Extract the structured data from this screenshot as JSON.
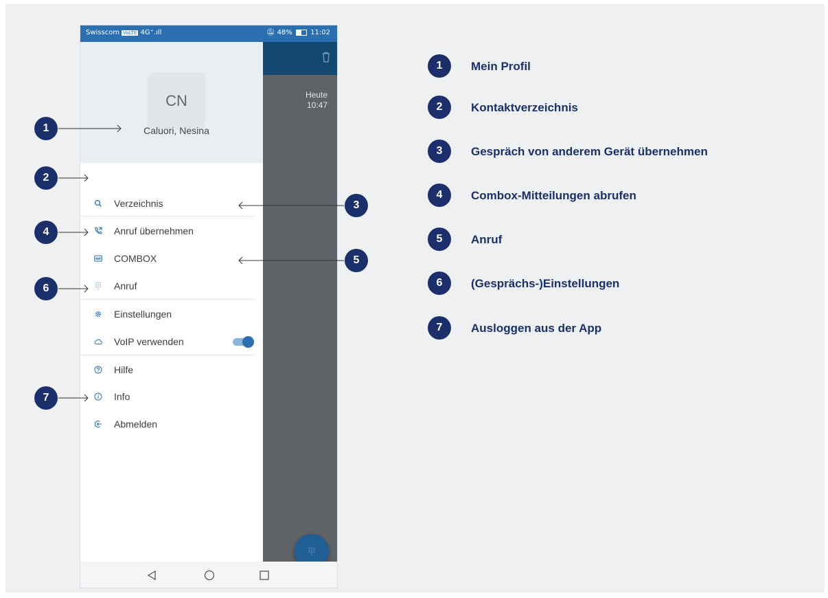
{
  "status_bar": {
    "carrier": "Swisscom",
    "network_tag": "VoLTE",
    "signal": "4G⁺.ıll",
    "battery": "48%",
    "time": "11:02"
  },
  "background_app": {
    "date_line1": "Heute",
    "date_line2": "10:47"
  },
  "profile": {
    "initials": "CN",
    "name": "Caluori, Nesina"
  },
  "menu": [
    {
      "label": "Verzeichnis",
      "icon": "search-icon"
    },
    {
      "label": "Anruf übernehmen",
      "icon": "phone-transfer-icon"
    },
    {
      "label": "COMBOX",
      "icon": "voicemail-icon"
    },
    {
      "label": "Anruf",
      "icon": "dialpad-icon"
    },
    {
      "label": "Einstellungen",
      "icon": "gear-icon"
    },
    {
      "label": "VoIP verwenden",
      "icon": "cloud-icon",
      "toggle": "on"
    },
    {
      "label": "Hilfe",
      "icon": "help-icon"
    },
    {
      "label": "Info",
      "icon": "info-icon"
    },
    {
      "label": "Abmelden",
      "icon": "logout-icon"
    }
  ],
  "callouts": {
    "n1": "1",
    "n2": "2",
    "n3": "3",
    "n4": "4",
    "n5": "5",
    "n6": "6",
    "n7": "7"
  },
  "legend": [
    {
      "number": "1",
      "text": "Mein Profil"
    },
    {
      "number": "2",
      "text": "Kontaktverzeichnis"
    },
    {
      "number": "3",
      "text": "Gespräch von anderem Gerät übernehmen"
    },
    {
      "number": "4",
      "text": "Combox-Mitteilungen abrufen"
    },
    {
      "number": "5",
      "text": "Anruf"
    },
    {
      "number": "6",
      "text": "(Gesprächs-)Einstellungen"
    },
    {
      "number": "7",
      "text": "Ausloggen aus der App"
    }
  ],
  "colors": {
    "callout": "#1b2f6b",
    "accent": "#2a6fb0",
    "appbar": "#134870",
    "scrim": "#5f6366",
    "page_bg": "#eef0f2"
  }
}
